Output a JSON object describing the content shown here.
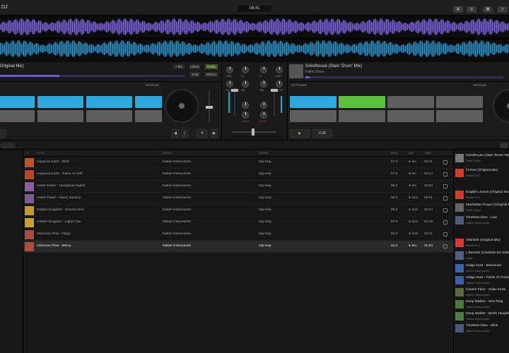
{
  "app": {
    "title": "DJ",
    "clock": "08:41"
  },
  "toolbar": {
    "icons": [
      "layout-icon",
      "wave-icon",
      "grid-icon",
      "list-icon"
    ]
  },
  "deckA": {
    "title": "Original Mix)",
    "chips": [
      "+ 0m",
      "LOCK",
      "SYNC",
      "-0.42",
      "PITCH"
    ],
    "pads_label": "HOTCUE",
    "pads": [
      "blue",
      "blue",
      "blue",
      "blue",
      "gray",
      "gray",
      "gray",
      "gray"
    ],
    "transport": [
      "◀",
      "|",
      "4",
      "▶"
    ],
    "progress": 0.32
  },
  "deckB": {
    "title": "Grindhouse (Slam 'Drum' Mix)",
    "subtitle": "Pallet Slave",
    "pads_label": "HOTCUES",
    "pads_right_label": "HOTCUE",
    "pads": [
      "blue",
      "green",
      "gray",
      "gray",
      "gray",
      "gray",
      "gray",
      "gray"
    ],
    "transport": [
      "▶",
      "CUE"
    ],
    "progress": 0.02
  },
  "mixer": {
    "labels": [
      "GAIN",
      "HI",
      "MID",
      "LOW",
      "FILTER"
    ],
    "cue_a": "CUE A",
    "cue_b": "CUE B"
  },
  "table": {
    "headers": [
      "#",
      "TITLE",
      "ARTIST",
      "GENRE",
      "BPM",
      "KEY",
      "TIME"
    ],
    "rows": [
      {
        "title": "Aquarius Earth - Birth",
        "artist": "Native Instruments",
        "genre": "Hip-Hop",
        "bpm": "87.0",
        "key": "● 4m",
        "time": "02:01",
        "color": "#c0532a"
      },
      {
        "title": "Aquarius Earth - Relax Yo Self",
        "artist": "Native Instruments",
        "genre": "Hip-Hop",
        "bpm": "87.0",
        "key": "● 6m",
        "time": "02:14",
        "color": "#b9482a"
      },
      {
        "title": "Astral Flutter - Hungarian Nights",
        "artist": "Native Instruments",
        "genre": "Hip-Hop",
        "bpm": "90.0",
        "key": "● 2m",
        "time": "02:00",
        "color": "#8a5fa0"
      },
      {
        "title": "Astral Flutter - Starry Monkey",
        "artist": "Native Instruments",
        "genre": "Hip-Hop",
        "bpm": "90.0",
        "key": "● 11m",
        "time": "02:01",
        "color": "#7c5a95"
      },
      {
        "title": "Golden Kingdom - Ground Zero",
        "artist": "Native Instruments",
        "genre": "Hip-Hop",
        "bpm": "85.0",
        "key": "● 11m",
        "time": "02:24",
        "color": "#c49a2b"
      },
      {
        "title": "Golden Kingdom - Lights Out",
        "artist": "Native Instruments",
        "genre": "Hip-Hop",
        "bpm": "87.0",
        "key": "● 11m",
        "time": "02:19",
        "color": "#c7a030"
      },
      {
        "title": "Infamous Flow - Dippy",
        "artist": "Native Instruments",
        "genre": "Hip-Hop",
        "bpm": "91.0",
        "key": "● 12m",
        "time": "02:21",
        "color": "#a84a3d"
      },
      {
        "title": "Infamous Flow - Mercy",
        "artist": "Native Instruments",
        "genre": "Hip-Hop",
        "bpm": "91.0",
        "key": "● 2m",
        "time": "01:54",
        "color": "#b24d3c",
        "selected": true
      }
    ]
  },
  "prep": [
    {
      "title": "Grindhouse (Slam 'Drum' Mix)",
      "sub": "Pallet Slave",
      "color": "#777777"
    },
    {
      "title": "Former (Original Mix)",
      "sub": "Reflekt 571",
      "color": "#d43a2f"
    },
    {
      "title": "English Lesson (Original Mix)",
      "sub": "Reflekt 571",
      "color": "#d43a2f"
    },
    {
      "title": "Manhattan Project (Original Mix)",
      "sub": "Pallet Slave",
      "color": "#666666"
    },
    {
      "title": "Timeless Slow - Lisa",
      "sub": "Native Instruments",
      "color": "#4c5d7a"
    },
    {
      "title": "Atlantide (Original Mix)",
      "sub": "Reflekt 571",
      "color": "#d43a2f"
    },
    {
      "title": "L'Éternité (Charlotte De Witte)",
      "sub": "Ninja",
      "color": "#4f5f8a"
    },
    {
      "title": "Indigo Dust - Blumental",
      "sub": "Native Instruments",
      "color": "#3b64a8"
    },
    {
      "title": "Indigo Dust - Fields Of Creation",
      "sub": "Native Instruments",
      "color": "#3a5fa2"
    },
    {
      "title": "Cavern Floor - Solar Kesis",
      "sub": "Native Instruments",
      "color": "#5a6a3a"
    },
    {
      "title": "Deep Mather - SK2 Ring",
      "sub": "Native Instruments",
      "color": "#4a7a3a"
    },
    {
      "title": "Deep Mather - Berlin Hauptbahnhof",
      "sub": "Native Instruments",
      "color": "#4d7d3d"
    },
    {
      "title": "Timeless Slow - Mine",
      "sub": "Native Instruments",
      "color": "#4a5a7a"
    }
  ]
}
